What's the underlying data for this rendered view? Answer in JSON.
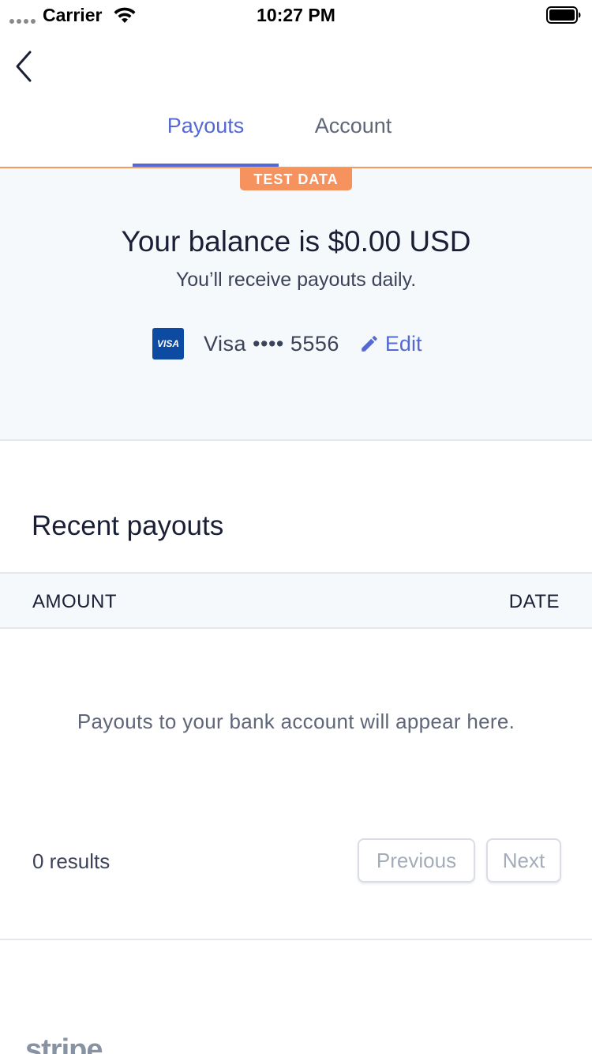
{
  "status_bar": {
    "carrier": "Carrier",
    "time": "10:27 PM",
    "signal_icon": "signal-dots-icon",
    "wifi_icon": "wifi-icon",
    "battery_icon": "battery-icon"
  },
  "nav": {
    "back_icon": "chevron-left-icon"
  },
  "tabs": [
    {
      "label": "Payouts",
      "active": true
    },
    {
      "label": "Account",
      "active": false
    }
  ],
  "balance": {
    "badge": "TEST DATA",
    "title": "Your balance is $0.00 USD",
    "subtitle": "You’ll receive payouts daily.",
    "card_brand_logo": "VISA",
    "card_label": "Visa •••• 5556",
    "edit_label": "Edit",
    "edit_icon": "pencil-icon"
  },
  "recent": {
    "title": "Recent payouts",
    "columns": [
      "AMOUNT",
      "DATE"
    ],
    "empty_message": "Payouts to your bank account will appear here.",
    "results": "0 results",
    "previous_label": "Previous",
    "next_label": "Next"
  },
  "footer": {
    "logo_text": "stripe"
  },
  "colors": {
    "accent": "#5469d4",
    "test_badge": "#f5925e",
    "panel_bg": "#f6f9fc",
    "visa_blue": "#0d4aa2"
  }
}
